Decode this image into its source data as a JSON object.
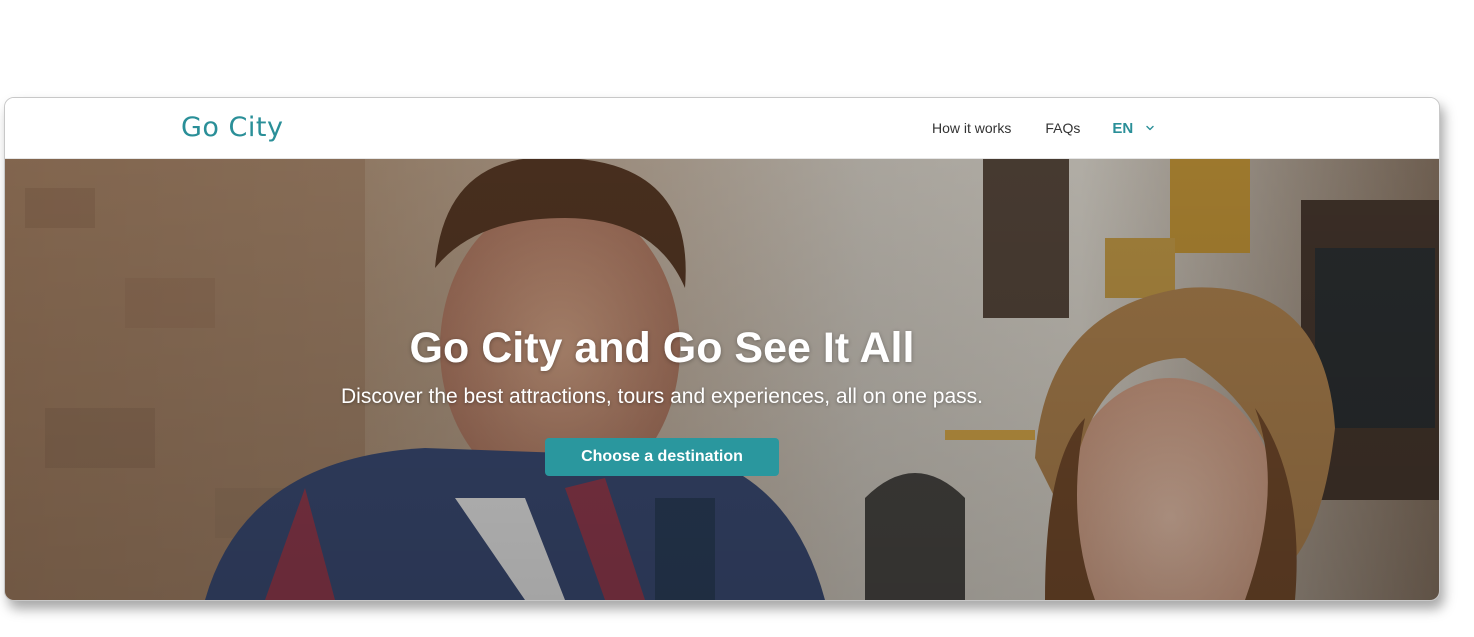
{
  "header": {
    "logo_text": "Go City",
    "nav_links": [
      "How it works",
      "FAQs"
    ],
    "language": "EN"
  },
  "hero": {
    "title": "Go City and Go See It All",
    "subtitle": "Discover the best attractions, tours and experiences, all on one pass.",
    "cta_label": "Choose a destination"
  },
  "colors": {
    "brand": "#2a8f98",
    "cta": "#2a979e"
  },
  "icons": {
    "language_chevron": "chevron-down-icon"
  }
}
